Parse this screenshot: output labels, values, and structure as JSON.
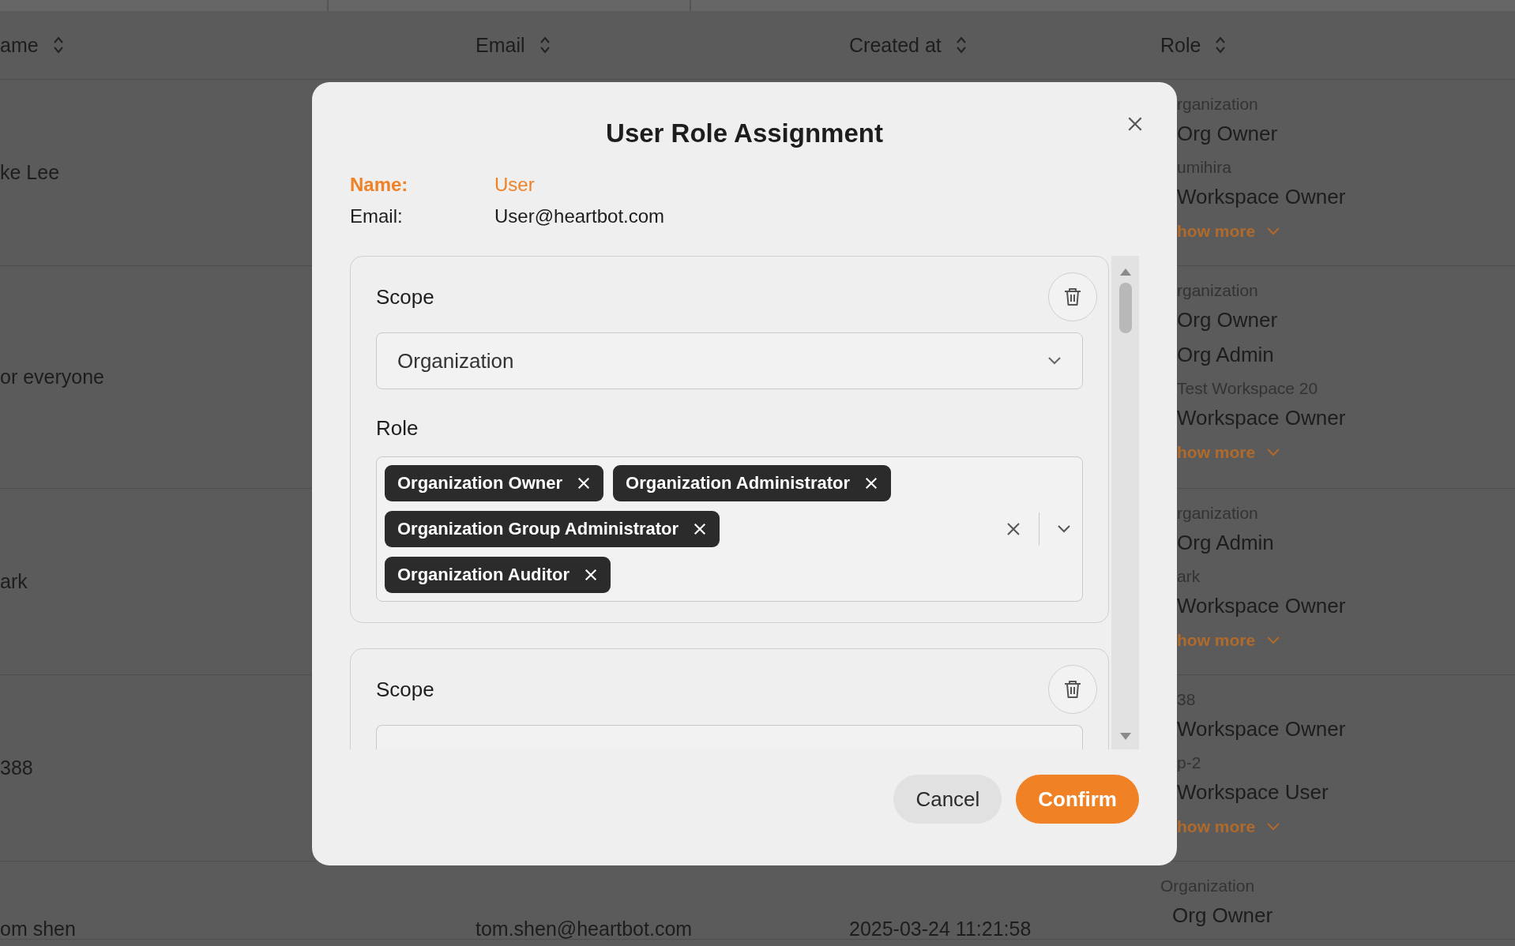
{
  "table": {
    "columns": [
      {
        "label": "ame"
      },
      {
        "label": "Email"
      },
      {
        "label": "Created at"
      },
      {
        "label": "Role"
      }
    ],
    "rows": [
      {
        "name": "ke Lee",
        "roles": [
          {
            "kind": "scope",
            "text": "rganization"
          },
          {
            "kind": "role",
            "text": "Org Owner"
          },
          {
            "kind": "scope",
            "text": "umihira"
          },
          {
            "kind": "role",
            "text": "Workspace Owner"
          },
          {
            "kind": "more",
            "text": "how more"
          }
        ]
      },
      {
        "name": "or everyone",
        "roles": [
          {
            "kind": "scope",
            "text": "rganization"
          },
          {
            "kind": "role",
            "text": "Org Owner"
          },
          {
            "kind": "role",
            "text": "Org Admin"
          },
          {
            "kind": "scope",
            "text": "Test Workspace 20"
          },
          {
            "kind": "role",
            "text": "Workspace Owner"
          },
          {
            "kind": "more",
            "text": "how more"
          }
        ]
      },
      {
        "name": "ark",
        "roles": [
          {
            "kind": "scope",
            "text": "rganization"
          },
          {
            "kind": "role",
            "text": "Org Admin"
          },
          {
            "kind": "scope",
            "text": "ark"
          },
          {
            "kind": "role",
            "text": "Workspace Owner"
          },
          {
            "kind": "more",
            "text": "how more"
          }
        ]
      },
      {
        "name": "388",
        "roles": [
          {
            "kind": "scope",
            "text": "38"
          },
          {
            "kind": "role",
            "text": "Workspace Owner"
          },
          {
            "kind": "scope",
            "text": "p-2"
          },
          {
            "kind": "role",
            "text": "Workspace User"
          },
          {
            "kind": "more",
            "text": "how more"
          }
        ]
      },
      {
        "name": "om shen",
        "email": "tom.shen@heartbot.com",
        "created_at": "2025-03-24 11:21:58",
        "roles": [
          {
            "kind": "scope",
            "text": "Organization"
          },
          {
            "kind": "role",
            "text": "Org Owner"
          }
        ]
      }
    ]
  },
  "dialog": {
    "title": "User Role Assignment",
    "fields": [
      {
        "label": "Name:",
        "value": "User",
        "highlighted": true
      },
      {
        "label": "Email:",
        "value": "User@heartbot.com",
        "highlighted": false
      }
    ],
    "assignments": [
      {
        "scope_label": "Scope",
        "scope": "Organization",
        "role_label": "Role",
        "roles": [
          "Organization Owner",
          "Organization Administrator",
          "Organization Group Administrator",
          "Organization Auditor"
        ]
      },
      {
        "scope_label": "Scope"
      }
    ],
    "buttons": [
      {
        "label": "Cancel",
        "kind": "secondary"
      },
      {
        "label": "Confirm",
        "kind": "primary"
      }
    ]
  }
}
